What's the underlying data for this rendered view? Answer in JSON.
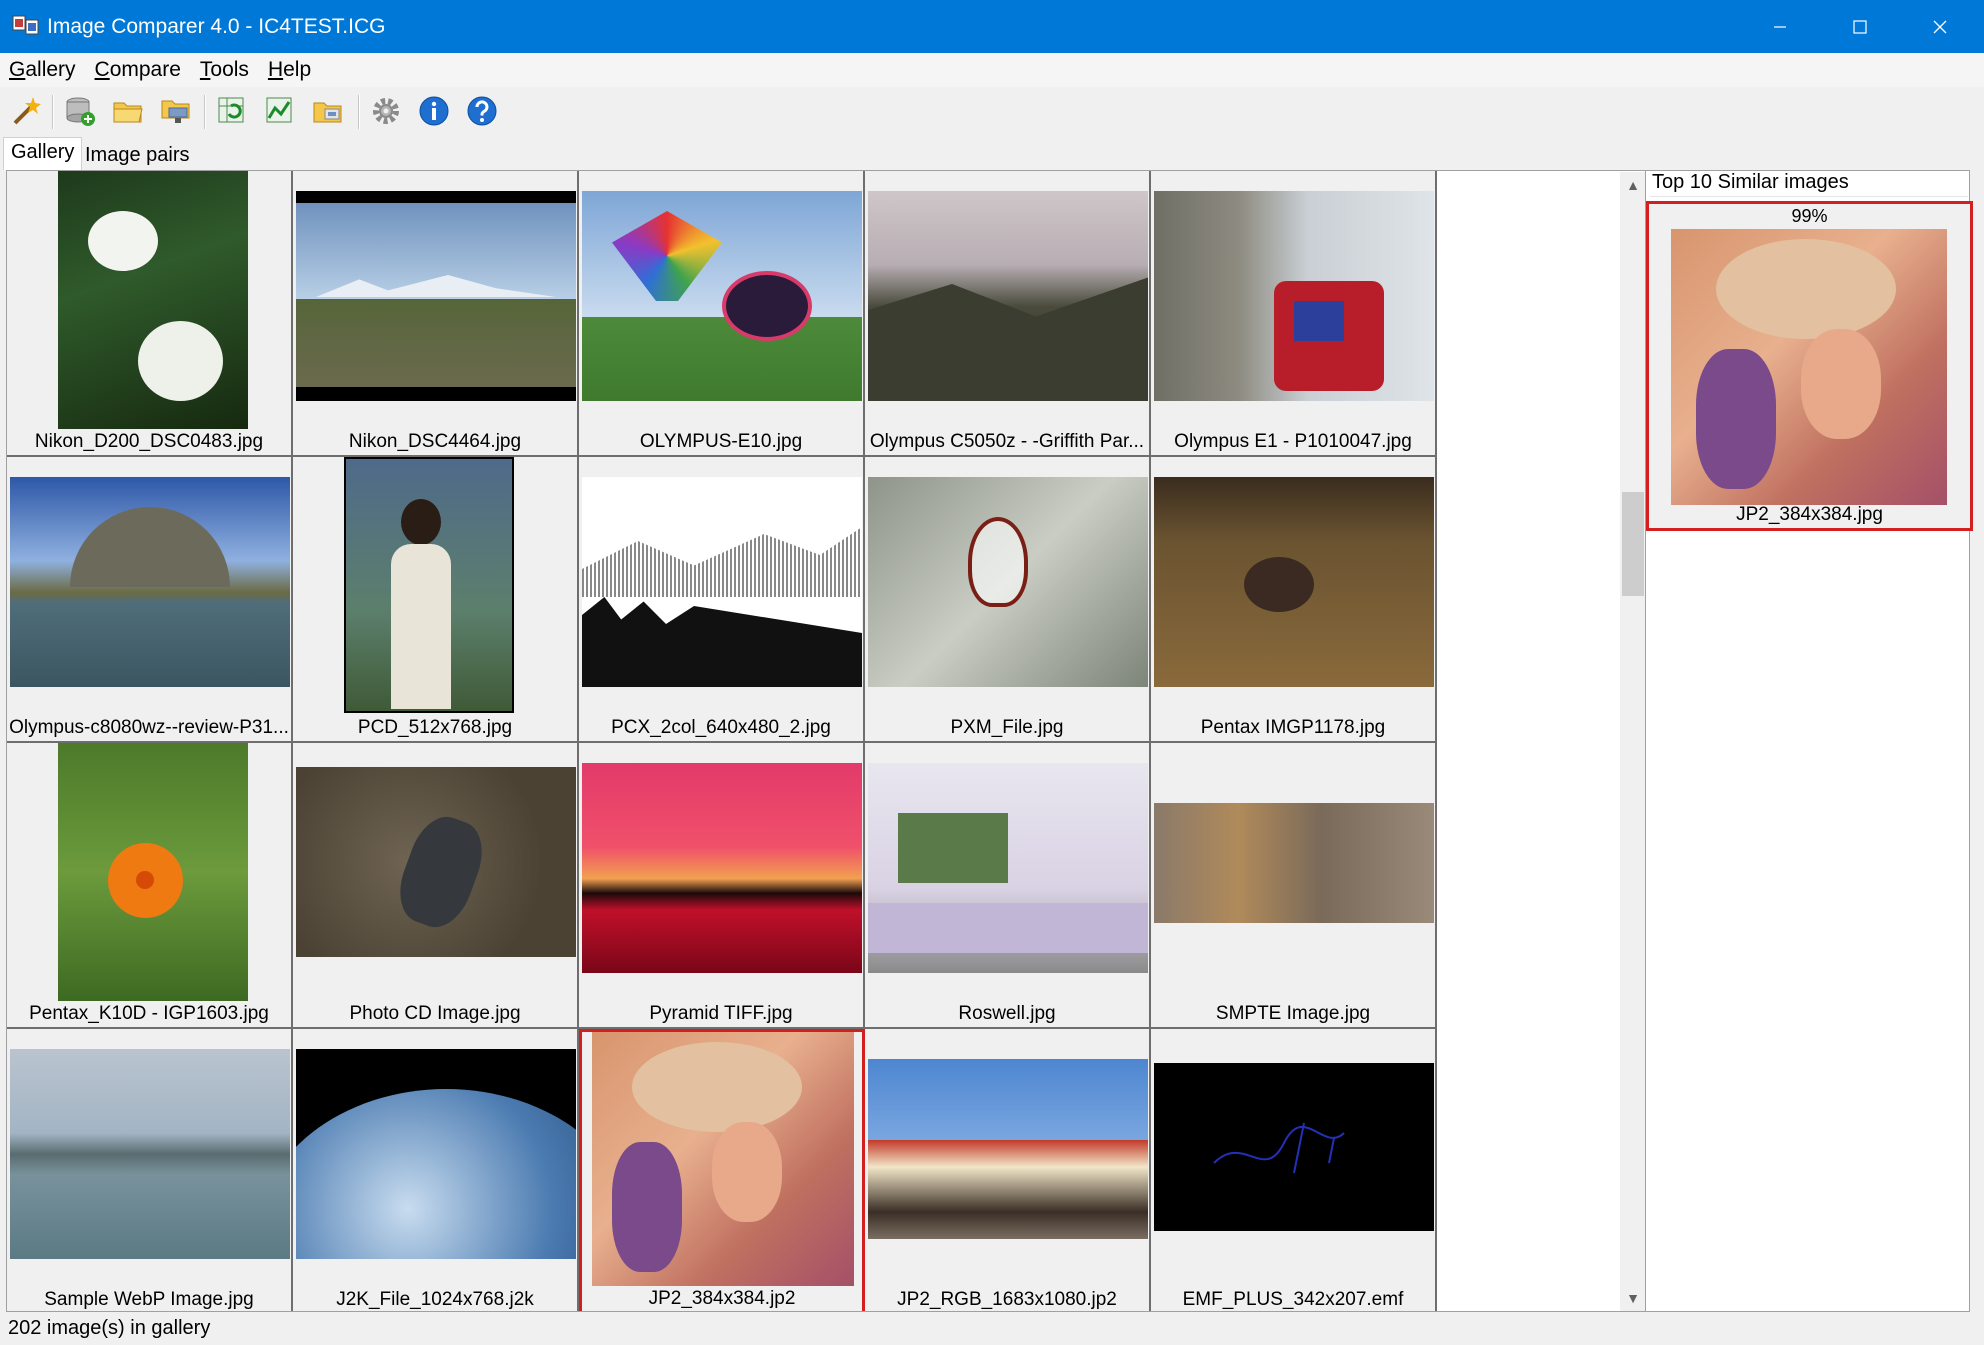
{
  "window": {
    "title": "Image Comparer 4.0 - IC4TEST.ICG",
    "min_glyph": "—",
    "max_glyph": "☐",
    "close_glyph": "✕"
  },
  "menu": [
    {
      "first": "G",
      "rest": "allery"
    },
    {
      "first": "C",
      "rest": "ompare"
    },
    {
      "first": "T",
      "rest": "ools"
    },
    {
      "first": "H",
      "rest": "elp"
    }
  ],
  "toolbar_icons": [
    "magic-wand-icon",
    "add-database-icon",
    "open-folder-icon",
    "folder-network-icon",
    "refresh-table-icon",
    "chart-compare-icon",
    "folder-files-icon",
    "gear-icon",
    "info-icon",
    "help-icon"
  ],
  "tabs": {
    "gallery": "Gallery",
    "pairs": "Image pairs"
  },
  "gallery": {
    "items": [
      {
        "label": "Nikon_D200_DSC0483.jpg"
      },
      {
        "label": "Nikon_DSC4464.jpg"
      },
      {
        "label": "OLYMPUS-E10.jpg"
      },
      {
        "label": "Olympus C5050z  - -Griffith Par..."
      },
      {
        "label": "Olympus E1 - P1010047.jpg"
      },
      {
        "label": "Olympus-c8080wz--review-P31..."
      },
      {
        "label": "PCD_512x768.jpg"
      },
      {
        "label": "PCX_2col_640x480_2.jpg"
      },
      {
        "label": "PXM_File.jpg"
      },
      {
        "label": "Pentax IMGP1178.jpg"
      },
      {
        "label": "Pentax_K10D - IGP1603.jpg"
      },
      {
        "label": "Photo CD Image.jpg"
      },
      {
        "label": "Pyramid TIFF.jpg"
      },
      {
        "label": "Roswell.jpg"
      },
      {
        "label": "SMPTE Image.jpg"
      },
      {
        "label": "Sample WebP Image.jpg"
      },
      {
        "label": "J2K_File_1024x768.j2k"
      },
      {
        "label": "JP2_384x384.jp2"
      },
      {
        "label": "JP2_RGB_1683x1080.jp2"
      },
      {
        "label": "EMF_PLUS_342x207.emf"
      }
    ],
    "selected_label": "JP2_384x384.jp2"
  },
  "similar": {
    "title": "Top 10 Similar images",
    "percent": "99%",
    "label": "JP2_384x384.jpg"
  },
  "status": "202 image(s) in gallery",
  "colors": {
    "titlebar": "#0078d7",
    "selection": "#d21f1f"
  }
}
